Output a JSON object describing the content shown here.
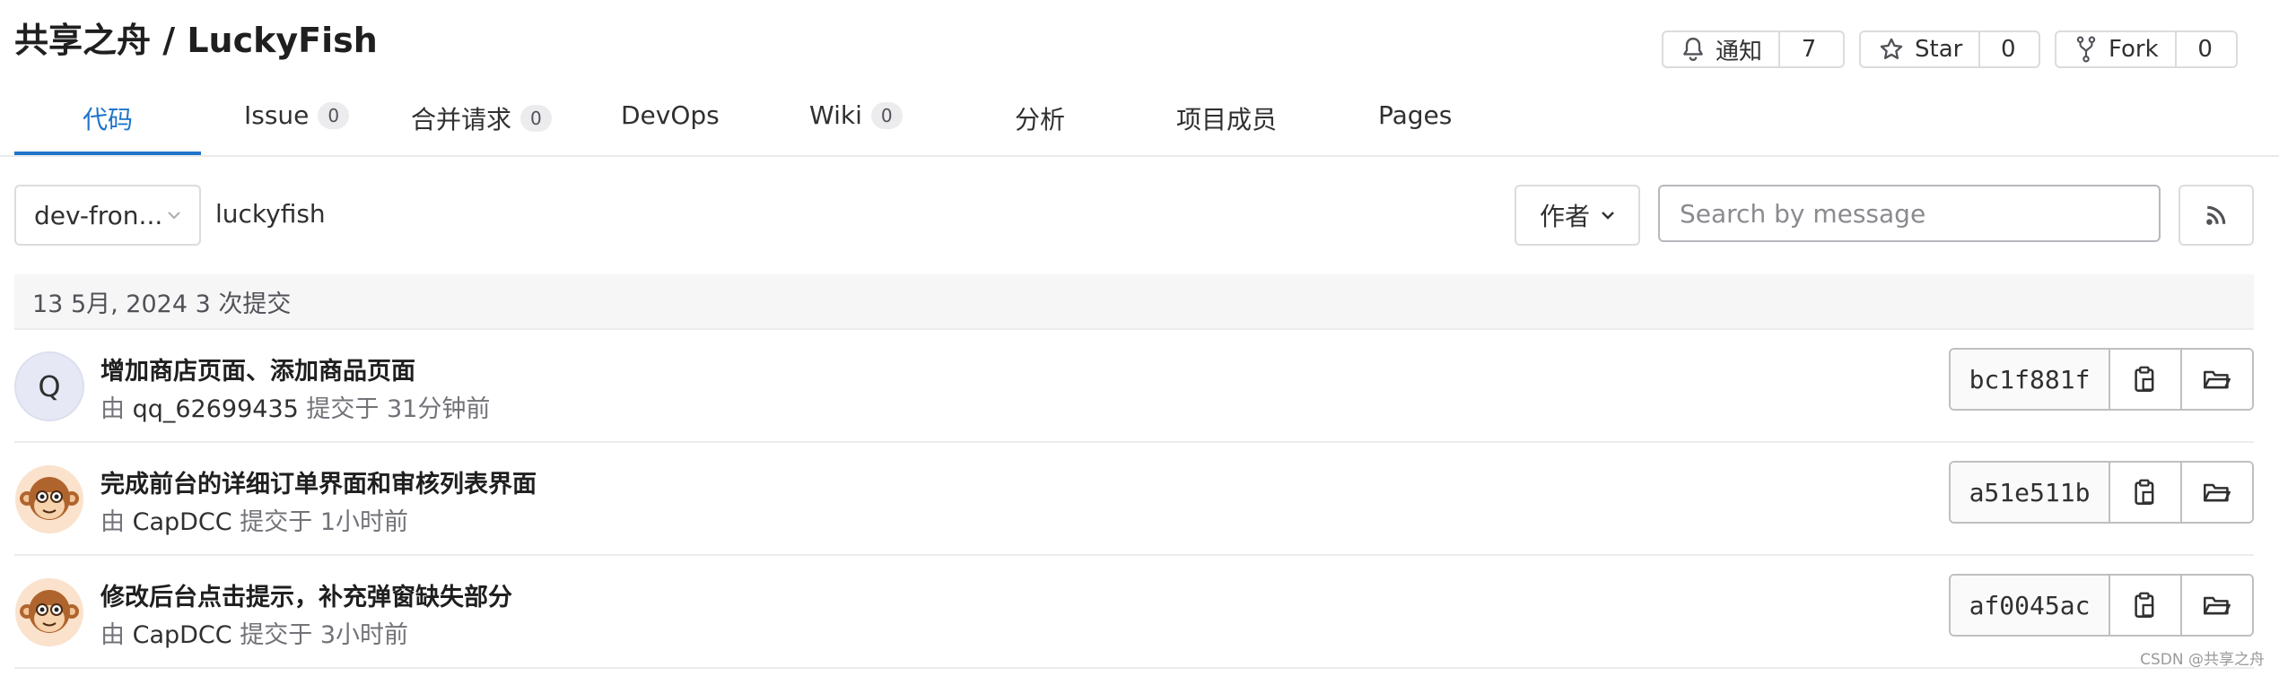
{
  "header": {
    "title": "共享之舟 / LuckyFish",
    "notify": {
      "label": "通知",
      "count": "7",
      "icon": "bell-icon"
    },
    "star": {
      "label": "Star",
      "count": "0",
      "icon": "star-icon"
    },
    "fork": {
      "label": "Fork",
      "count": "0",
      "icon": "fork-icon"
    }
  },
  "tabs": [
    {
      "label": "代码",
      "badge": null,
      "active": true
    },
    {
      "label": "Issue",
      "badge": "0"
    },
    {
      "label": "合并请求",
      "badge": "0"
    },
    {
      "label": "DevOps",
      "badge": null
    },
    {
      "label": "Wiki",
      "badge": "0"
    },
    {
      "label": "分析",
      "badge": null
    },
    {
      "label": "项目成员",
      "badge": null
    },
    {
      "label": "Pages",
      "badge": null
    }
  ],
  "toolbar": {
    "branch": "dev-fron...",
    "path": "luckyfish",
    "author_filter": "作者",
    "search_placeholder": "Search by message",
    "rss_icon": "rss-icon"
  },
  "commits": {
    "day_header": "13 5月, 2024 3 次提交",
    "items": [
      {
        "avatar": "Q",
        "title": "增加商店页面、添加商品页面",
        "by": "由",
        "author": "qq_62699435",
        "time": "提交于 31分钟前",
        "sha": "bc1f881f"
      },
      {
        "avatar": "monkey",
        "title": "完成前台的详细订单界面和审核列表界面",
        "by": "由",
        "author": "CapDCC",
        "time": "提交于 1小时前",
        "sha": "a51e511b"
      },
      {
        "avatar": "monkey",
        "title": "修改后台点击提示，补充弹窗缺失部分",
        "by": "由",
        "author": "CapDCC",
        "time": "提交于 3小时前",
        "sha": "af0045ac"
      }
    ]
  },
  "watermark": "CSDN @共享之舟",
  "colors": {
    "accent": "#1f75cb",
    "border": "#dcdcde",
    "muted": "#737278"
  }
}
